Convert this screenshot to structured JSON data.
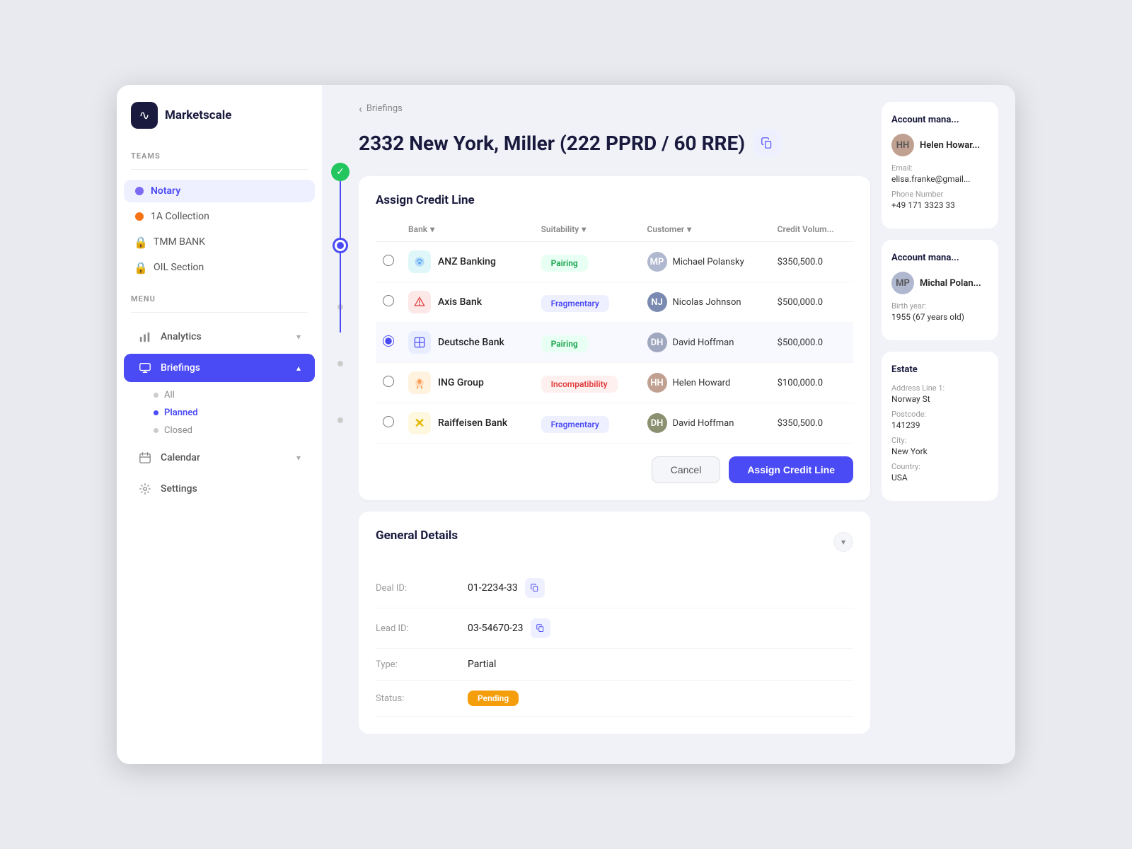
{
  "app": {
    "logo_text": "Marketscale",
    "logo_symbol": "∿"
  },
  "sidebar": {
    "teams_label": "TEAMS",
    "menu_label": "MENU",
    "teams": [
      {
        "id": "notary",
        "label": "Notary",
        "type": "dot",
        "dot_color": "#7c6af5",
        "active": true
      },
      {
        "id": "1a-collection",
        "label": "1A Collection",
        "type": "dot",
        "dot_color": "#f97316",
        "active": false
      },
      {
        "id": "tmm-bank",
        "label": "TMM BANK",
        "type": "lock",
        "active": false
      },
      {
        "id": "oil-section",
        "label": "OIL Section",
        "type": "lock",
        "active": false
      }
    ],
    "menu_items": [
      {
        "id": "analytics",
        "label": "Analytics",
        "icon": "bar-chart",
        "active": false,
        "has_chevron": true
      },
      {
        "id": "briefings",
        "label": "Briefings",
        "icon": "monitor",
        "active": true,
        "has_chevron": true
      },
      {
        "id": "calendar",
        "label": "Calendar",
        "icon": "calendar",
        "active": false,
        "has_chevron": true
      },
      {
        "id": "settings",
        "label": "Settings",
        "icon": "gear",
        "active": false,
        "has_chevron": false
      }
    ],
    "briefings_sub": [
      {
        "id": "all",
        "label": "All",
        "active": false
      },
      {
        "id": "planned",
        "label": "Planned",
        "active": true
      },
      {
        "id": "closed",
        "label": "Closed",
        "active": false
      }
    ]
  },
  "breadcrumb": {
    "back_label": "Briefings"
  },
  "page": {
    "title": "2332 New York, Miller (222 PPRD / 60 RRE)"
  },
  "assign_credit": {
    "title": "Assign Credit Line",
    "columns": [
      {
        "key": "select",
        "label": ""
      },
      {
        "key": "bank",
        "label": "Bank"
      },
      {
        "key": "suitability",
        "label": "Suitability"
      },
      {
        "key": "customer",
        "label": "Customer"
      },
      {
        "key": "credit_volume",
        "label": "Credit Volum..."
      }
    ],
    "rows": [
      {
        "id": "anz",
        "bank_name": "ANZ Banking",
        "bank_color": "#e0f7f9",
        "bank_text": "🏦",
        "suitability": "Pairing",
        "suitability_type": "green",
        "customer_name": "Michael Polansky",
        "customer_color": "#b0b8d0",
        "customer_initials": "MP",
        "credit_amount": "$350,500.0",
        "selected": false
      },
      {
        "id": "axis",
        "bank_name": "Axis Bank",
        "bank_color": "#fde8e8",
        "bank_text": "🏛",
        "suitability": "Fragmentary",
        "suitability_type": "blue",
        "customer_name": "Nicolas Johnson",
        "customer_color": "#7a8ab0",
        "customer_initials": "NJ",
        "credit_amount": "$500,000.0",
        "selected": false
      },
      {
        "id": "deutsche",
        "bank_name": "Deutsche Bank",
        "bank_color": "#e8eeff",
        "bank_text": "□",
        "suitability": "Pairing",
        "suitability_type": "green",
        "customer_name": "David Hoffman",
        "customer_color": "#a0a8c0",
        "customer_initials": "DH",
        "credit_amount": "$500,000.0",
        "selected": true
      },
      {
        "id": "ing",
        "bank_name": "ING Group",
        "bank_color": "#fff3e0",
        "bank_text": "🦁",
        "suitability": "Incompatibility",
        "suitability_type": "red",
        "customer_name": "Helen Howard",
        "customer_color": "#c0a090",
        "customer_initials": "HH",
        "credit_amount": "$100,000.0",
        "selected": false
      },
      {
        "id": "raiffeisen",
        "bank_name": "Raiffeisen Bank",
        "bank_color": "#fff8e0",
        "bank_text": "✕",
        "suitability": "Fragmentary",
        "suitability_type": "blue",
        "customer_name": "David Hoffman",
        "customer_color": "#8a9070",
        "customer_initials": "DH2",
        "credit_amount": "$350,500.0",
        "selected": false
      }
    ],
    "cancel_label": "Cancel",
    "assign_label": "Assign Credit Line"
  },
  "general_details": {
    "title": "General Details",
    "fields": [
      {
        "label": "Deal ID:",
        "value": "01-2234-33",
        "has_copy": true
      },
      {
        "label": "Lead ID:",
        "value": "03-54670-23",
        "has_copy": true
      },
      {
        "label": "Type:",
        "value": "Partial",
        "has_copy": false
      },
      {
        "label": "Status:",
        "value": "Pending",
        "is_badge": true
      }
    ]
  },
  "account_manager_1": {
    "title": "Account mana...",
    "name": "Helen Howar...",
    "avatar_initials": "HH",
    "avatar_color": "#c0a090",
    "email_label": "Email:",
    "email": "elisa.franke@gmail...",
    "phone_label": "Phone Number",
    "phone": "+49 171 3323 33"
  },
  "account_manager_2": {
    "title": "Account mana...",
    "name": "Michal Polan...",
    "avatar_initials": "MP",
    "avatar_color": "#b0b8d0",
    "birth_year_label": "Birth year:",
    "birth_year": "1955 (67 years old)"
  },
  "estate": {
    "title": "Estate",
    "address_line1_label": "Address Line 1:",
    "address_line1": "Norway St",
    "postcode_label": "Postcode:",
    "postcode": "141239",
    "city_label": "City:",
    "city": "New York",
    "country_label": "Country:",
    "country": "USA"
  }
}
